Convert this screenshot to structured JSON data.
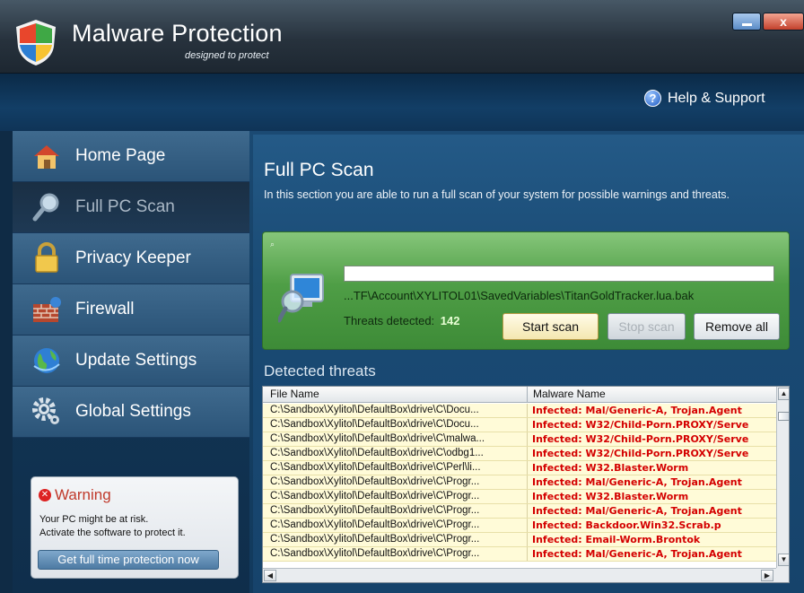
{
  "app": {
    "title": "Malware Protection",
    "subtitle": "designed to protect",
    "close_label": "x"
  },
  "header": {
    "help_label": "Help & Support",
    "help_icon": "question-icon"
  },
  "sidebar": {
    "items": [
      {
        "label": "Home Page",
        "icon": "home-icon",
        "active": false
      },
      {
        "label": "Full PC Scan",
        "icon": "magnifier-icon",
        "active": true
      },
      {
        "label": "Privacy Keeper",
        "icon": "padlock-icon",
        "active": false
      },
      {
        "label": "Firewall",
        "icon": "brick-wall-icon",
        "active": false
      },
      {
        "label": "Update Settings",
        "icon": "globe-icon",
        "active": false
      },
      {
        "label": "Global Settings",
        "icon": "gears-icon",
        "active": false
      }
    ],
    "warning": {
      "title": "Warning",
      "line1": "Your PC might be at risk.",
      "line2": "Activate the software to protect it.",
      "button": "Get full time protection now"
    }
  },
  "main": {
    "title": "Full PC Scan",
    "description": "In this section you are able to run a full scan of your system for possible warnings and threats.",
    "scan": {
      "current_path": "...TF\\Account\\XYLITOL01\\SavedVariables\\TitanGoldTracker.lua.bak",
      "threats_label": "Threats detected:",
      "threats_count": "142",
      "start_button": "Start scan",
      "stop_button": "Stop scan",
      "remove_button": "Remove all"
    },
    "detected": {
      "title": "Detected threats",
      "columns": {
        "file": "File Name",
        "malware": "Malware Name"
      },
      "rows": [
        {
          "file": "C:\\Sandbox\\Xylitol\\DefaultBox\\drive\\C\\Docu...",
          "malware": "Infected: Mal/Generic-A, Trojan.Agent"
        },
        {
          "file": "C:\\Sandbox\\Xylitol\\DefaultBox\\drive\\C\\Docu...",
          "malware": "Infected: W32/Child-Porn.PROXY/Serve"
        },
        {
          "file": "C:\\Sandbox\\Xylitol\\DefaultBox\\drive\\C\\malwa...",
          "malware": "Infected: W32/Child-Porn.PROXY/Serve"
        },
        {
          "file": "C:\\Sandbox\\Xylitol\\DefaultBox\\drive\\C\\odbg1...",
          "malware": "Infected: W32/Child-Porn.PROXY/Serve"
        },
        {
          "file": "C:\\Sandbox\\Xylitol\\DefaultBox\\drive\\C\\Perl\\li...",
          "malware": "Infected: W32.Blaster.Worm"
        },
        {
          "file": "C:\\Sandbox\\Xylitol\\DefaultBox\\drive\\C\\Progr...",
          "malware": "Infected: Mal/Generic-A, Trojan.Agent"
        },
        {
          "file": "C:\\Sandbox\\Xylitol\\DefaultBox\\drive\\C\\Progr...",
          "malware": "Infected: W32.Blaster.Worm"
        },
        {
          "file": "C:\\Sandbox\\Xylitol\\DefaultBox\\drive\\C\\Progr...",
          "malware": "Infected: Mal/Generic-A, Trojan.Agent"
        },
        {
          "file": "C:\\Sandbox\\Xylitol\\DefaultBox\\drive\\C\\Progr...",
          "malware": "Infected: Backdoor.Win32.Scrab.p"
        },
        {
          "file": "C:\\Sandbox\\Xylitol\\DefaultBox\\drive\\C\\Progr...",
          "malware": "Infected: Email-Worm.Brontok"
        },
        {
          "file": "C:\\Sandbox\\Xylitol\\DefaultBox\\drive\\C\\Progr...",
          "malware": "Infected: Mal/Generic-A, Trojan.Agent"
        }
      ]
    }
  },
  "colors": {
    "accent_green": "#4f9e46",
    "infected_red": "#d40000",
    "sidebar_blue": "#3f6a8e",
    "threat_count": "#e8ffd5"
  }
}
